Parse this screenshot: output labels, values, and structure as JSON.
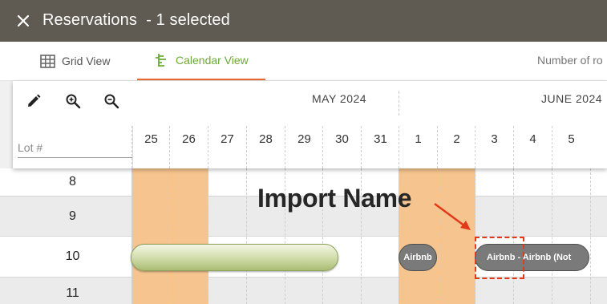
{
  "titlebar": {
    "close_icon": "close-icon",
    "title": "Reservations  - 1 selected"
  },
  "tabs": {
    "grid_view": {
      "label": "Grid View",
      "icon": "grid-icon"
    },
    "calendar_view": {
      "label": "Calendar View",
      "icon": "calendar-timeline-icon",
      "active": true
    },
    "rooms_label": "Number of ro"
  },
  "toolbar": {
    "edit_icon": "pencil-icon",
    "zoom_in_icon": "zoom-in-icon",
    "zoom_out_icon": "zoom-out-icon",
    "lot_placeholder": "Lot #"
  },
  "calendar": {
    "months": [
      "MAY 2024",
      "JUNE 2024"
    ],
    "days": [
      "25",
      "26",
      "27",
      "28",
      "29",
      "30",
      "31",
      "1",
      "2",
      "3",
      "4",
      "5"
    ],
    "lots": [
      "8",
      "9",
      "10",
      "11"
    ]
  },
  "reservations": [
    {
      "lot": "10",
      "label": ""
    },
    {
      "lot": "10",
      "label": "Airbnb"
    },
    {
      "lot": "10",
      "label": "Airbnb - Airbnb (Not"
    }
  ],
  "annotation": {
    "text": "Import Name"
  },
  "colors": {
    "titlebar": "#5f5a52",
    "active_tab": "#6aab34",
    "tab_underline": "#ea6a32",
    "weekend_fill": "#f6c48e",
    "reservation_gray": "#7a7a7a",
    "annotation_red": "#e23a18"
  }
}
